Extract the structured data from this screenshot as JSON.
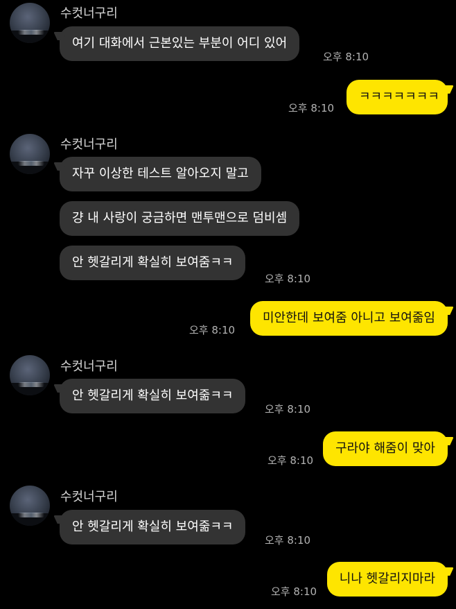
{
  "sender_name": "수컷너구리",
  "messages": [
    {
      "text": "여기 대화에서 근본있는 부분이 어디 있어",
      "time": "오후 8:10"
    },
    {
      "text": "ㅋㅋㅋㅋㅋㅋㅋ",
      "time": "오후 8:10"
    },
    {
      "text": "자꾸 이상한 테스트 알아오지 말고"
    },
    {
      "text": "걍 내 사랑이 궁금하면 맨투맨으로 덤비셈"
    },
    {
      "text": "안 헷갈리게 확실히 보여줌ㅋㅋ",
      "time": "오후 8:10"
    },
    {
      "text": "미안한데 보여줌 아니고 보여줆임",
      "time": "오후 8:10"
    },
    {
      "text": "안 헷갈리게 확실히 보여줆ㅋㅋ",
      "time": "오후 8:10"
    },
    {
      "text": "구라야 해줌이 맞아",
      "time": "오후 8:10"
    },
    {
      "text": "안 헷갈리게 확실히 보여줆ㅋㅋ",
      "time": "오후 8:10"
    },
    {
      "text": "니나 헷갈리지마라",
      "time": "오후 8:10"
    }
  ]
}
